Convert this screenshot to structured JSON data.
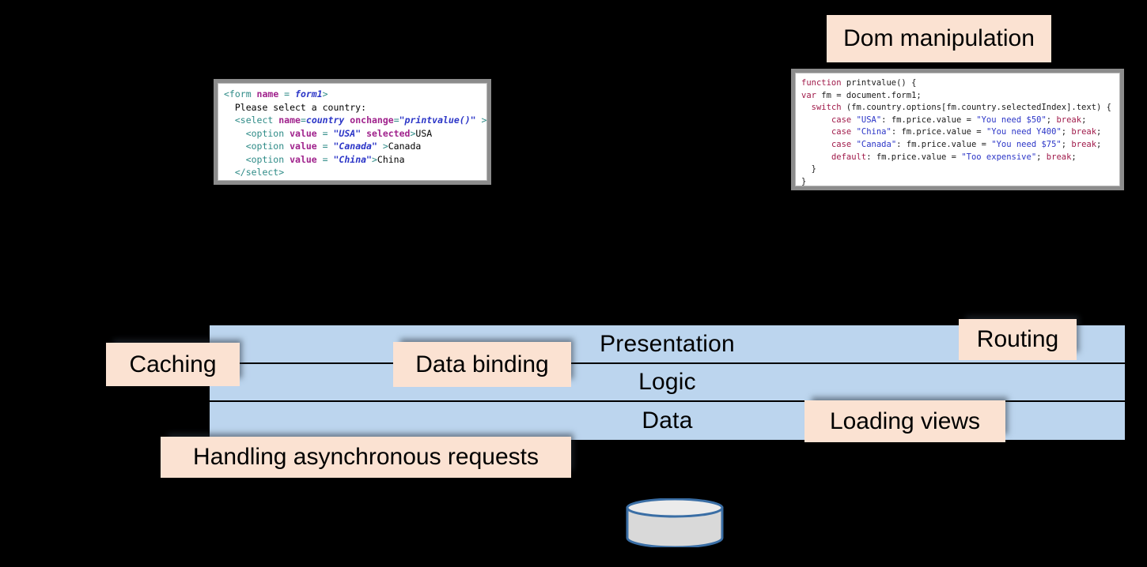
{
  "diagram": {
    "title_tags": {
      "dom_manipulation": "Dom manipulation",
      "caching": "Caching",
      "data_binding": "Data binding",
      "routing": "Routing",
      "loading_views": "Loading views",
      "handling_async": "Handling asynchronous requests"
    },
    "layers": [
      {
        "id": "presentation",
        "label": "Presentation"
      },
      {
        "id": "logic",
        "label": "Logic"
      },
      {
        "id": "data",
        "label": "Data"
      }
    ],
    "database": {
      "label": "",
      "icon": "database-cylinder-icon"
    },
    "colors": {
      "layer_fill": "#bcd5ee",
      "tag_fill": "#fbe2d2",
      "background": "#000000",
      "line": "#000000",
      "db_fill": "#d9d9d9",
      "db_stroke": "#3a6ea5"
    }
  },
  "html_code": {
    "title": "html-form-snippet",
    "lines": [
      [
        {
          "t": "tag",
          "v": "<form "
        },
        {
          "t": "attr",
          "v": "name"
        },
        {
          "t": "tag",
          "v": " = "
        },
        {
          "t": "val",
          "v": "form1"
        },
        {
          "t": "tag",
          "v": ">"
        }
      ],
      [
        {
          "t": "text",
          "v": "  Please select a country:"
        }
      ],
      [
        {
          "t": "tag",
          "v": "  <select "
        },
        {
          "t": "attr",
          "v": "name"
        },
        {
          "t": "tag",
          "v": "="
        },
        {
          "t": "val",
          "v": "country"
        },
        {
          "t": "tag",
          "v": " "
        },
        {
          "t": "attr",
          "v": "onchange"
        },
        {
          "t": "tag",
          "v": "="
        },
        {
          "t": "val",
          "v": "\"printvalue()\""
        },
        {
          "t": "tag",
          "v": " >"
        }
      ],
      [
        {
          "t": "tag",
          "v": "    <option "
        },
        {
          "t": "attr",
          "v": "value"
        },
        {
          "t": "tag",
          "v": " = "
        },
        {
          "t": "val",
          "v": "\"USA\""
        },
        {
          "t": "tag",
          "v": " "
        },
        {
          "t": "attr",
          "v": "selected"
        },
        {
          "t": "tag",
          "v": ">"
        },
        {
          "t": "text",
          "v": "USA"
        }
      ],
      [
        {
          "t": "tag",
          "v": "    <option "
        },
        {
          "t": "attr",
          "v": "value"
        },
        {
          "t": "tag",
          "v": " = "
        },
        {
          "t": "val",
          "v": "\"Canada\""
        },
        {
          "t": "tag",
          "v": " >"
        },
        {
          "t": "text",
          "v": "Canada"
        }
      ],
      [
        {
          "t": "tag",
          "v": "    <option "
        },
        {
          "t": "attr",
          "v": "value"
        },
        {
          "t": "tag",
          "v": " = "
        },
        {
          "t": "val",
          "v": "\"China\""
        },
        {
          "t": "tag",
          "v": ">"
        },
        {
          "t": "text",
          "v": "China"
        }
      ],
      [
        {
          "t": "tag",
          "v": "  </select>"
        }
      ]
    ]
  },
  "js_code": {
    "title": "javascript-printvalue-snippet",
    "lines": [
      [
        {
          "t": "kw",
          "v": "function"
        },
        {
          "t": "plain",
          "v": " printvalue() {"
        }
      ],
      [
        {
          "t": "kw",
          "v": "var"
        },
        {
          "t": "plain",
          "v": " fm = document.form1;"
        }
      ],
      [
        {
          "t": "plain",
          "v": "  "
        },
        {
          "t": "kw",
          "v": "switch"
        },
        {
          "t": "plain",
          "v": " (fm.country.options[fm.country.selectedIndex].text) {"
        }
      ],
      [
        {
          "t": "plain",
          "v": "      "
        },
        {
          "t": "kw",
          "v": "case"
        },
        {
          "t": "plain",
          "v": " "
        },
        {
          "t": "str",
          "v": "\"USA\""
        },
        {
          "t": "plain",
          "v": ": fm.price.value = "
        },
        {
          "t": "str",
          "v": "\"You need $50\""
        },
        {
          "t": "plain",
          "v": "; "
        },
        {
          "t": "kw",
          "v": "break"
        },
        {
          "t": "plain",
          "v": ";"
        }
      ],
      [
        {
          "t": "plain",
          "v": "      "
        },
        {
          "t": "kw",
          "v": "case"
        },
        {
          "t": "plain",
          "v": " "
        },
        {
          "t": "str",
          "v": "\"China\""
        },
        {
          "t": "plain",
          "v": ": fm.price.value = "
        },
        {
          "t": "str",
          "v": "\"You need Y400\""
        },
        {
          "t": "plain",
          "v": "; "
        },
        {
          "t": "kw",
          "v": "break"
        },
        {
          "t": "plain",
          "v": ";"
        }
      ],
      [
        {
          "t": "plain",
          "v": "      "
        },
        {
          "t": "kw",
          "v": "case"
        },
        {
          "t": "plain",
          "v": " "
        },
        {
          "t": "str",
          "v": "\"Canada\""
        },
        {
          "t": "plain",
          "v": ": fm.price.value = "
        },
        {
          "t": "str",
          "v": "\"You need $75\""
        },
        {
          "t": "plain",
          "v": "; "
        },
        {
          "t": "kw",
          "v": "break"
        },
        {
          "t": "plain",
          "v": ";"
        }
      ],
      [
        {
          "t": "plain",
          "v": "      "
        },
        {
          "t": "kw",
          "v": "default"
        },
        {
          "t": "plain",
          "v": ": fm.price.value = "
        },
        {
          "t": "str",
          "v": "\"Too expensive\""
        },
        {
          "t": "plain",
          "v": "; "
        },
        {
          "t": "kw",
          "v": "break"
        },
        {
          "t": "plain",
          "v": ";"
        }
      ],
      [
        {
          "t": "plain",
          "v": "  }"
        }
      ],
      [
        {
          "t": "plain",
          "v": "}"
        }
      ]
    ]
  }
}
